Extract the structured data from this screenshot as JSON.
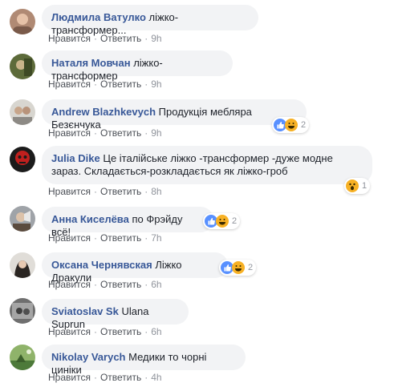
{
  "comments": [
    {
      "author": "Людмила Ватулко",
      "text": "ліжко-трансформер...",
      "like": "Нравится",
      "reply": "Ответить",
      "time": "9h"
    },
    {
      "author": "Наталя Мовчан",
      "text": "ліжко-трансформер",
      "like": "Нравится",
      "reply": "Ответить",
      "time": "9h"
    },
    {
      "author": "Andrew Blazhkevych",
      "text": "Продукція мебляра Безєнчука",
      "like": "Нравится",
      "reply": "Ответить",
      "time": "9h",
      "reactions": "2"
    },
    {
      "author": "Julia Dike",
      "text": "Це італійське ліжко -трансформер -дуже модне зараз. Складається-розкладається як ліжко-гроб",
      "like": "Нравится",
      "reply": "Ответить",
      "time": "8h",
      "reactions": "1"
    },
    {
      "author": "Анна Киселёва",
      "text": "по Фрэйду всё!",
      "like": "Нравится",
      "reply": "Ответить",
      "time": "7h",
      "reactions": "2"
    },
    {
      "author": "Оксана Чернявская",
      "text": "Ліжко Дракули",
      "like": "Нравится",
      "reply": "Ответить",
      "time": "6h",
      "reactions": "2"
    },
    {
      "author": "Sviatoslav Sk",
      "text": "Ulana Suprun",
      "like": "Нравится",
      "reply": "Ответить",
      "time": "6h"
    },
    {
      "author": "Nikolay Varych",
      "text": "Медики то чорні циніки",
      "like": "Нравится",
      "reply": "Ответить",
      "time": "4h"
    }
  ],
  "colors": {
    "author": "#385898",
    "bubble": "#f2f3f5",
    "meta": "#90949c",
    "like_blue": "#5890ff",
    "haha_yellow": "#f7b125"
  }
}
